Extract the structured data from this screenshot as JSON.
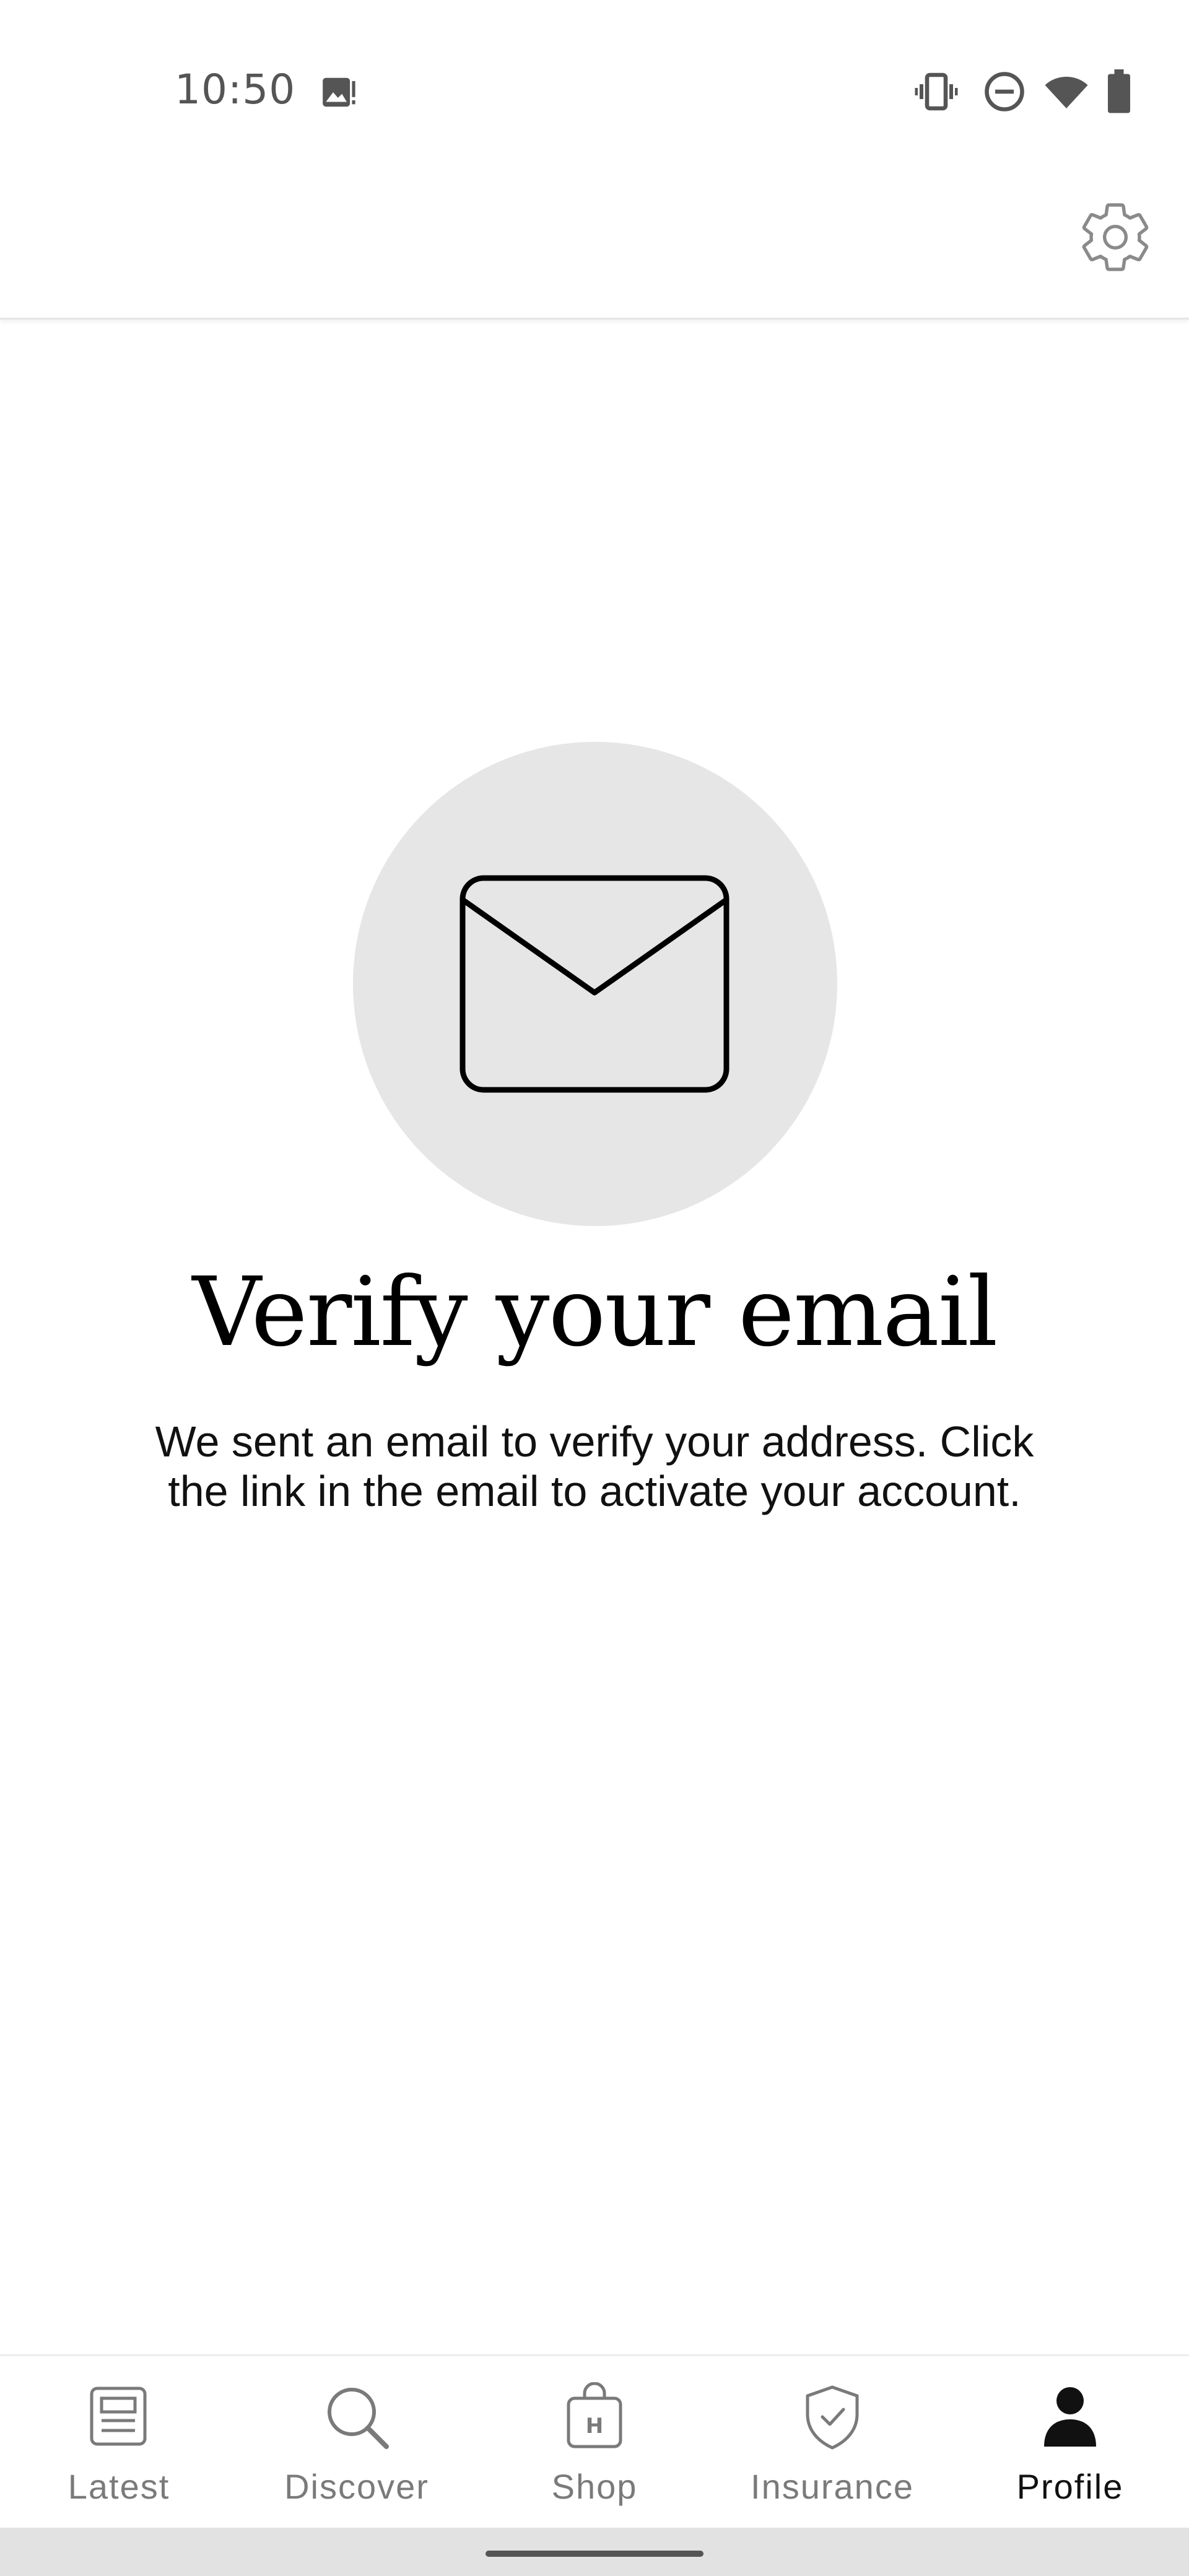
{
  "status_bar": {
    "time": "10:50",
    "icons": [
      "image-notification-icon",
      "vibrate-icon",
      "do-not-disturb-icon",
      "wifi-icon",
      "battery-icon"
    ]
  },
  "app_bar": {
    "settings_icon": "gear-icon"
  },
  "main": {
    "icon": "envelope-icon",
    "title": "Verify your email",
    "message_line1": "We sent an email to verify your address. Click",
    "message_line2": "the link in the email to activate your account."
  },
  "bottom_nav": {
    "items": [
      {
        "label": "Latest",
        "icon": "newspaper-icon",
        "active": false
      },
      {
        "label": "Discover",
        "icon": "search-icon",
        "active": false
      },
      {
        "label": "Shop",
        "icon": "shopping-bag-icon",
        "active": false
      },
      {
        "label": "Insurance",
        "icon": "shield-check-icon",
        "active": false
      },
      {
        "label": "Profile",
        "icon": "person-icon",
        "active": true
      }
    ]
  },
  "colors": {
    "background": "#ffffff",
    "circle": "#e6e6e6",
    "text_primary": "#000000",
    "nav_inactive": "#7a7a7a",
    "nav_active": "#111111"
  }
}
